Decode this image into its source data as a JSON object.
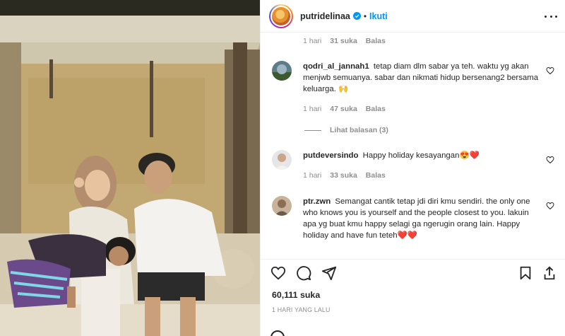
{
  "post": {
    "username": "putridelinaa",
    "follow_label": "Ikuti",
    "separator": "•"
  },
  "top_meta": {
    "time": "1 hari",
    "likes": "31 suka",
    "reply": "Balas"
  },
  "comments": [
    {
      "username": "qodri_al_jannah1",
      "text": "tetap diam dlm sabar ya teh. waktu yg akan menjwb semuanya. sabar dan nikmati hidup bersenang2 bersama keluarga. 🙌",
      "time": "1 hari",
      "likes": "47 suka",
      "reply": "Balas",
      "view_replies": "Lihat balasan (3)"
    },
    {
      "username": "putdeversindo",
      "text": "Happy holiday kesayangan😍❤️",
      "time": "1 hari",
      "likes": "33 suka",
      "reply": "Balas"
    },
    {
      "username": "ptr.zwn",
      "text": "Semangat cantik tetap jdi diri kmu sendiri. the only one who knows you is yourself and the people closest to you. lakuin apa yg buat kmu happy selagi ga ngerugin orang lain. Happy holiday and have fun teteh❤️❤️"
    }
  ],
  "likes_count": "60,111 suka",
  "post_date": "1 HARI YANG LALU",
  "colors": {
    "accent": "#0095f6",
    "text": "#262626",
    "muted": "#8e8e8e"
  },
  "icons": [
    "heart-icon",
    "comment-icon",
    "share-icon",
    "bookmark-icon",
    "more-icon",
    "verified-icon"
  ]
}
